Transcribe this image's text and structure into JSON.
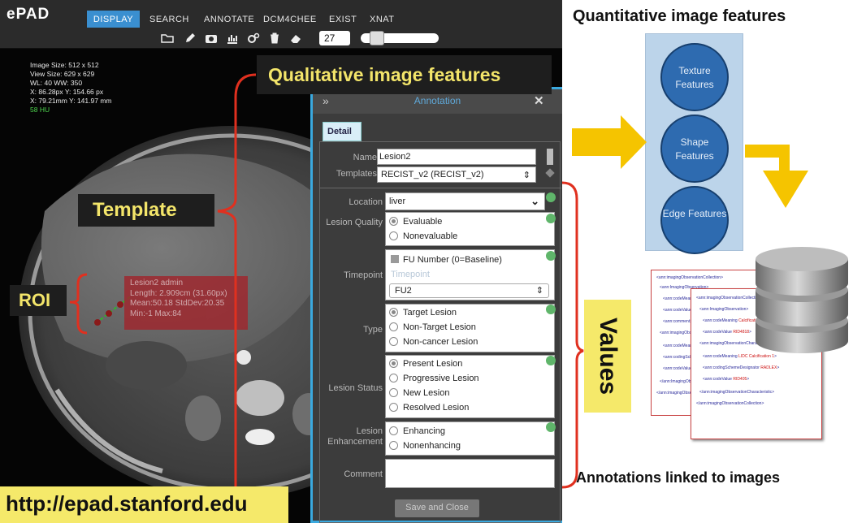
{
  "app": {
    "logo": "ePAD",
    "nav": [
      "DISPLAY",
      "SEARCH",
      "ANNOTATE",
      "DCM4CHEE",
      "EXIST",
      "XNAT"
    ],
    "toolbar_icons": [
      "folder-icon",
      "pencil-icon",
      "camera-icon",
      "chart-icon",
      "gears-icon",
      "trash-icon",
      "eraser-icon"
    ],
    "wl_value": "27"
  },
  "viewer_info": {
    "line1": "Image Size: 512 x 512",
    "line2": "View Size: 629 x 629",
    "line3": "WL: 40 WW: 350",
    "line4": "X: 86.28px Y: 154.66 px",
    "line5": "X: 79.21mm Y: 141.97 mm",
    "hu": "58 HU"
  },
  "roi_measure": {
    "line1": "Lesion2 admin",
    "line2": "Length: 2.909cm (31.60px)",
    "line3": "Mean:50.18 StdDev:20.35",
    "line4": "Min:-1 Max:84"
  },
  "annotation": {
    "title": "Annotation",
    "tab": "Detail",
    "name_label": "Name",
    "name_value": "Lesion2",
    "templates_label": "Templates",
    "templates_value": "RECIST_v2 (RECIST_v2)",
    "location_label": "Location",
    "location_value": "liver",
    "quality_label": "Lesion Quality",
    "quality_options": [
      "Evaluable",
      "Nonevaluable"
    ],
    "timepoint_label": "Timepoint",
    "timepoint_check": "FU Number (0=Baseline)",
    "timepoint_placeholder": "Timepoint",
    "timepoint_value": "FU2",
    "type_label": "Type",
    "type_options": [
      "Target Lesion",
      "Non-Target Lesion",
      "Non-cancer Lesion"
    ],
    "status_label": "Lesion Status",
    "status_options": [
      "Present Lesion",
      "Progressive Lesion",
      "New Lesion",
      "Resolved Lesion"
    ],
    "enh_label": "Lesion Enhancement",
    "enh_options": [
      "Enhancing",
      "Nonenhancing"
    ],
    "comment_label": "Comment",
    "save_label": "Save and Close"
  },
  "callouts": {
    "qualitative": "Qualitative image features",
    "template": "Template",
    "roi": "ROI",
    "values": "Values",
    "url": "http://epad.stanford.edu"
  },
  "right": {
    "quant_title": "Quantitative image features",
    "features": [
      "Texture Features",
      "Shape Features",
      "Edge Features"
    ],
    "linked_title": "Annotations linked to images"
  },
  "colors": {
    "accent": "#3aa9df",
    "callout_text": "#f3e56a",
    "label_bg": "#f5e96a",
    "bracket": "#e0301f",
    "arrow": "#f5c400",
    "feature_circle": "#2e6bb0"
  }
}
